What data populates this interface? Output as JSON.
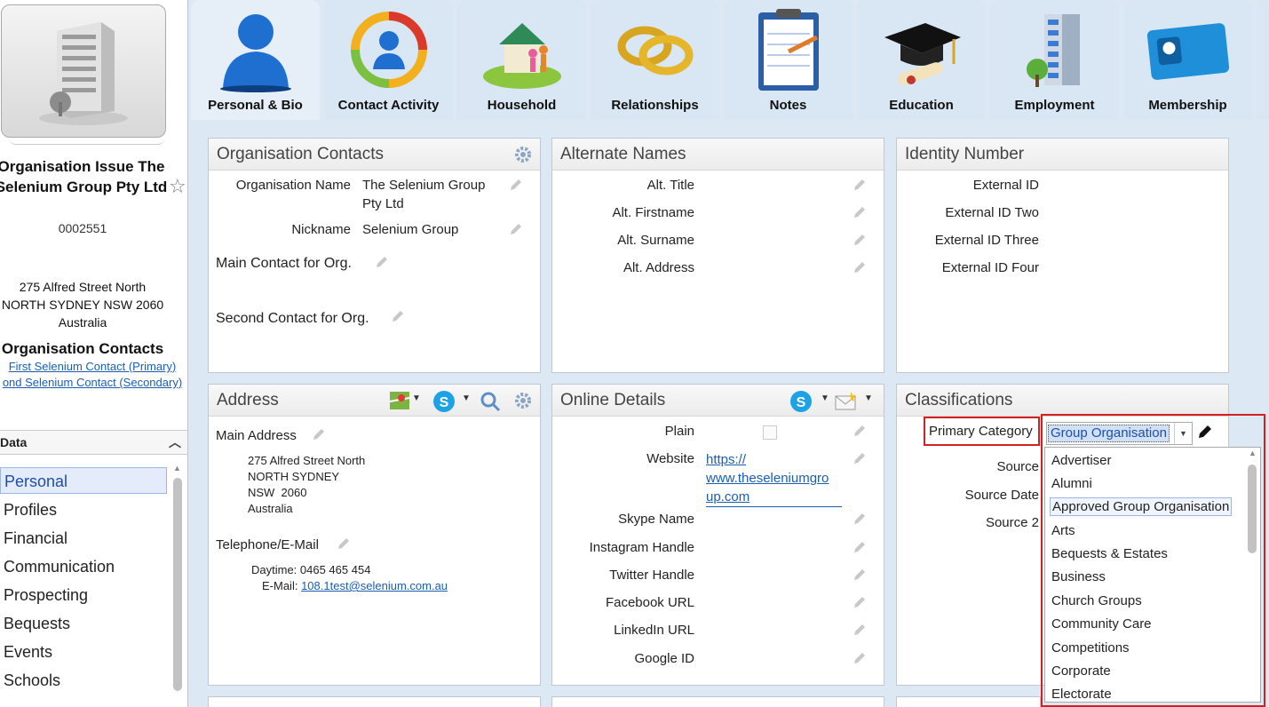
{
  "sidebar": {
    "org_name": "Organisation Issue The Selenium Group Pty Ltd",
    "org_id": "0002551",
    "address_lines": [
      "275 Alfred Street North",
      "NORTH SYDNEY NSW 2060",
      "Australia"
    ],
    "org_contacts_title": "Organisation Contacts",
    "contacts": [
      "First Selenium Contact (Primary)",
      "ond Selenium Contact (Secondary)"
    ],
    "data_header": "Data",
    "nav": [
      "Personal",
      "Profiles",
      "Financial",
      "Communication",
      "Prospecting",
      "Bequests",
      "Events",
      "Schools"
    ]
  },
  "tabs": [
    {
      "label": "Personal & Bio",
      "icon": "person-icon"
    },
    {
      "label": "Contact Activity",
      "icon": "contact-activity-icon"
    },
    {
      "label": "Household",
      "icon": "household-icon"
    },
    {
      "label": "Relationships",
      "icon": "rings-icon"
    },
    {
      "label": "Notes",
      "icon": "clipboard-icon"
    },
    {
      "label": "Education",
      "icon": "graduation-cap-icon"
    },
    {
      "label": "Employment",
      "icon": "building-icon"
    },
    {
      "label": "Membership",
      "icon": "membership-card-icon"
    }
  ],
  "org_contacts": {
    "title": "Organisation Contacts",
    "org_name_label": "Organisation Name",
    "org_name_value_1": "The Selenium Group",
    "org_name_value_2": "Pty Ltd",
    "nickname_label": "Nickname",
    "nickname_value": "Selenium Group",
    "main_contact_label": "Main Contact for Org.",
    "second_contact_label": "Second Contact for Org."
  },
  "alt_names": {
    "title": "Alternate Names",
    "labels": [
      "Alt. Title",
      "Alt. Firstname",
      "Alt. Surname",
      "Alt. Address"
    ]
  },
  "identity": {
    "title": "Identity Number",
    "labels": [
      "External ID",
      "External ID Two",
      "External ID Three",
      "External ID Four"
    ]
  },
  "address": {
    "title": "Address",
    "main_label": "Main Address",
    "lines": [
      "275 Alfred Street North",
      "NORTH SYDNEY",
      "NSW  2060",
      "Australia"
    ],
    "tel_label": "Telephone/E-Mail",
    "daytime": "Daytime: 0465 465 454",
    "email_label": "E-Mail:",
    "email": "108.1test@selenium.com.au"
  },
  "online": {
    "title": "Online Details",
    "labels": [
      "Plain",
      "Website",
      "Skype Name",
      "Instagram Handle",
      "Twitter Handle",
      "Facebook URL",
      "LinkedIn URL",
      "Google ID"
    ],
    "website_lines": [
      "https://",
      "www.theseleniumgro",
      "up.com"
    ]
  },
  "classifications": {
    "title": "Classifications",
    "primary_label": "Primary Category",
    "labels": [
      "Source",
      "Source Date",
      "Source 2"
    ],
    "selected": "Group Organisation",
    "options": [
      "Advertiser",
      "Alumni",
      "Approved Group Organisation",
      "Arts",
      "Bequests & Estates",
      "Business",
      "Church Groups",
      "Community Care",
      "Competitions",
      "Corporate",
      "Electorate"
    ]
  },
  "colors": {
    "accent": "#1f4fa8",
    "highlight_border": "#d42020",
    "link": "#1a5fb4"
  }
}
